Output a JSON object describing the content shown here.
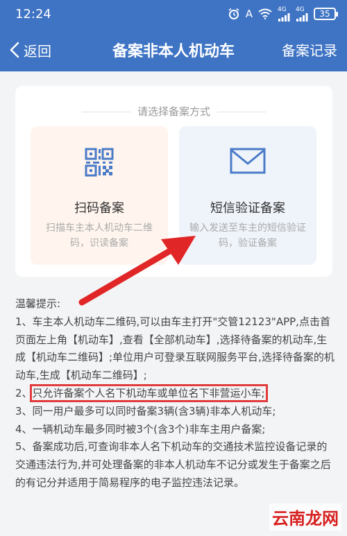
{
  "status_bar": {
    "time": "12:24",
    "a_label": "A",
    "signal_label_1": "4G",
    "signal_label_2": "4G",
    "battery": "35",
    "icons": [
      "alarm-icon",
      "wifi-icon",
      "signal-icon",
      "battery-icon"
    ]
  },
  "nav": {
    "back_label": "返回",
    "title": "备案非本人机动车",
    "action_label": "备案记录"
  },
  "card": {
    "title": "请选择备案方式",
    "options": [
      {
        "name": "扫码备案",
        "desc": "扫描车主本人机动车二维码，识读备案",
        "icon": "qr-code-icon"
      },
      {
        "name": "短信验证备案",
        "desc": "输入发送至车主的短信验证码，验证备案",
        "icon": "envelope-icon"
      }
    ]
  },
  "tips": {
    "title": "温馨提示:",
    "items": [
      "1、车主本人机动车二维码,可以由车主打开\"交管12123\"APP,点击首页面左上角【机动车】,查看【全部机动车】,选择待备案的机动车,生成【机动车二维码】;单位用户可登录互联网服务平台,选择待备案的机动车,生成【机动车二维码】;",
      "只允许备案个人名下机动车或单位名下非营运小车;",
      "3、同一用户最多可以同时备案3辆(含3辆)非本人机动车;",
      "4、一辆机动车最多同时被3个(含3个)非车主用户备案;",
      "5、备案成功后,可查询非本人名下机动车的交通技术监控设备记录的交通违法行为,并可处理备案的非本人机动车不记分或发生于备案之后的有记分并适用于简易程序的电子监控违法记录。"
    ],
    "item2_prefix": "2、"
  },
  "colors": {
    "header_bg": "#3f74c4",
    "highlight": "#e23b3b",
    "qr_option_bg": "#fff5ee",
    "sms_option_bg": "#eff4fb"
  },
  "watermark": "云南龙网"
}
